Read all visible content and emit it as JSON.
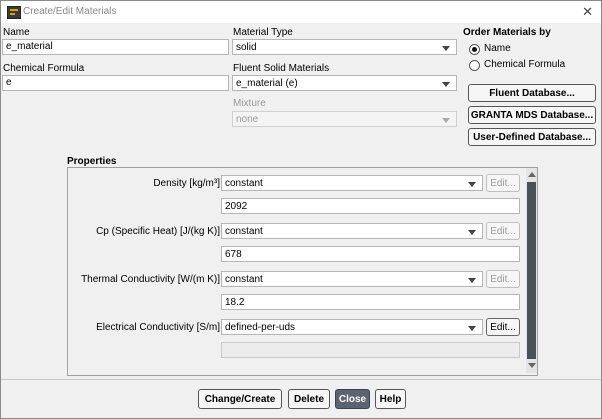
{
  "window": {
    "title": "Create/Edit Materials"
  },
  "name": {
    "label": "Name",
    "value": "e_material"
  },
  "formula": {
    "label": "Chemical Formula",
    "value": "e"
  },
  "material_type": {
    "label": "Material Type",
    "value": "solid"
  },
  "fluent_materials": {
    "label": "Fluent Solid Materials",
    "value": "e_material (e)"
  },
  "mixture": {
    "label": "Mixture",
    "value": "none"
  },
  "order": {
    "label": "Order Materials by",
    "options": [
      {
        "label": "Name",
        "selected": true
      },
      {
        "label": "Chemical Formula",
        "selected": false
      }
    ]
  },
  "db_buttons": {
    "fluent": "Fluent Database...",
    "granta": "GRANTA MDS Database...",
    "user": "User-Defined Database..."
  },
  "properties": {
    "heading": "Properties",
    "rows": [
      {
        "label": "Density [kg/m³]",
        "method": "constant",
        "edit": "Edit...",
        "edit_enabled": false,
        "value": "2092"
      },
      {
        "label": "Cp (Specific Heat) [J/(kg K)]",
        "method": "constant",
        "edit": "Edit...",
        "edit_enabled": false,
        "value": "678"
      },
      {
        "label": "Thermal Conductivity [W/(m K)]",
        "method": "constant",
        "edit": "Edit...",
        "edit_enabled": false,
        "value": "18.2"
      },
      {
        "label": "Electrical Conductivity [S/m]",
        "method": "defined-per-uds",
        "edit": "Edit...",
        "edit_enabled": true,
        "value": ""
      }
    ]
  },
  "footer": {
    "change_create": "Change/Create",
    "delete": "Delete",
    "close": "Close",
    "help": "Help"
  }
}
